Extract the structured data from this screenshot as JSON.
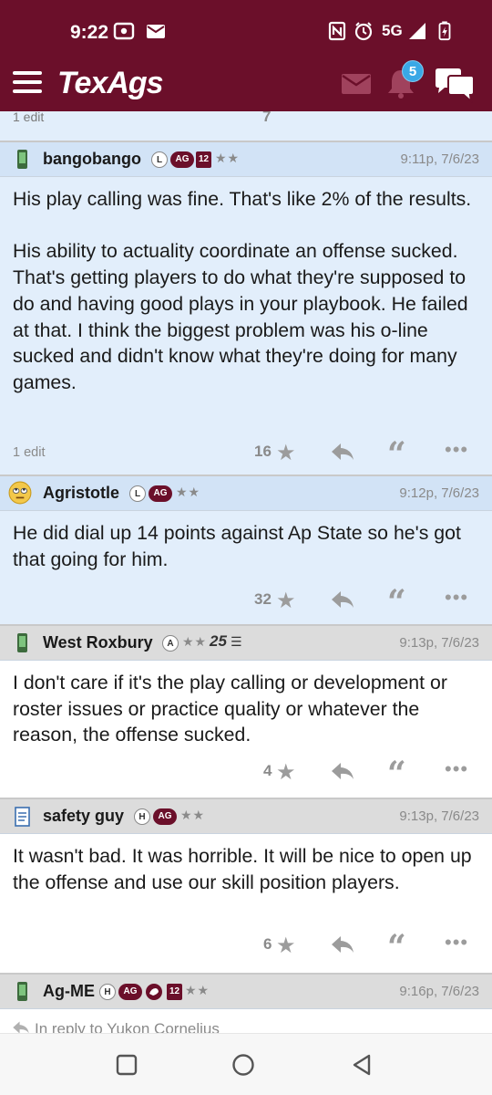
{
  "status_bar": {
    "time": "9:22",
    "network": "5G"
  },
  "app_bar": {
    "logo": "TexAgs",
    "notification_count": "5"
  },
  "previous_post": {
    "edit_note": "1 edit",
    "star_count": "7"
  },
  "posts": [
    {
      "username": "bangobango",
      "badges": [
        "L",
        "AG",
        "12"
      ],
      "stars": "★★",
      "timestamp": "9:11p, 7/6/23",
      "body": "His play calling was fine. That's like 2% of the results.\n\nHis ability to actuality coordinate an offense sucked. That's getting players to do what they're supposed to do and having good plays in your playbook. He failed at that. I think the biggest problem was his o-line sucked and didn't know what they're doing for many games.",
      "edit_note": "1 edit",
      "star_count": "16"
    },
    {
      "username": "Agristotle",
      "badges": [
        "L",
        "AG"
      ],
      "stars": "★★",
      "timestamp": "9:12p, 7/6/23",
      "body": "He did dial up 14 points against Ap State so he's got that going for him.",
      "edit_note": "",
      "star_count": "32"
    },
    {
      "username": "West Roxbury",
      "badges": [
        "A"
      ],
      "stars": "★★",
      "extra_badge": "25",
      "timestamp": "9:13p, 7/6/23",
      "body": "I don't care if it's the play calling or development or roster issues or practice quality or whatever the reason, the offense sucked.",
      "edit_note": "",
      "star_count": "4"
    },
    {
      "username": "safety guy",
      "badges": [
        "H",
        "AG"
      ],
      "stars": "★★",
      "timestamp": "9:13p, 7/6/23",
      "body": "It wasn't bad. It was horrible. It will be nice to open up the offense and use our skill position players.",
      "edit_note": "",
      "star_count": "6"
    },
    {
      "username": "Ag-ME",
      "badges": [
        "H",
        "AG",
        "12"
      ],
      "stars": "★★",
      "timestamp": "9:16p, 7/6/23",
      "reply_to": "In reply to Yukon Cornelius"
    }
  ],
  "icons": {
    "menu": "hamburger-icon",
    "mail": "mail-icon",
    "bell": "bell-icon",
    "chat": "chat-icon",
    "reply": "reply-arrow-icon",
    "quote": "quote-icon",
    "more": "more-dots-icon",
    "star": "star-icon",
    "phone_avatar": "phone-icon",
    "face_avatar": "rolling-eyes-emoji-icon",
    "notepad_avatar": "notepad-icon"
  },
  "colors": {
    "brand": "#6b0f2a",
    "highlight": "#e2eefb",
    "header_gray": "#dcdcdc",
    "badge_blue": "#3aa8e6"
  }
}
